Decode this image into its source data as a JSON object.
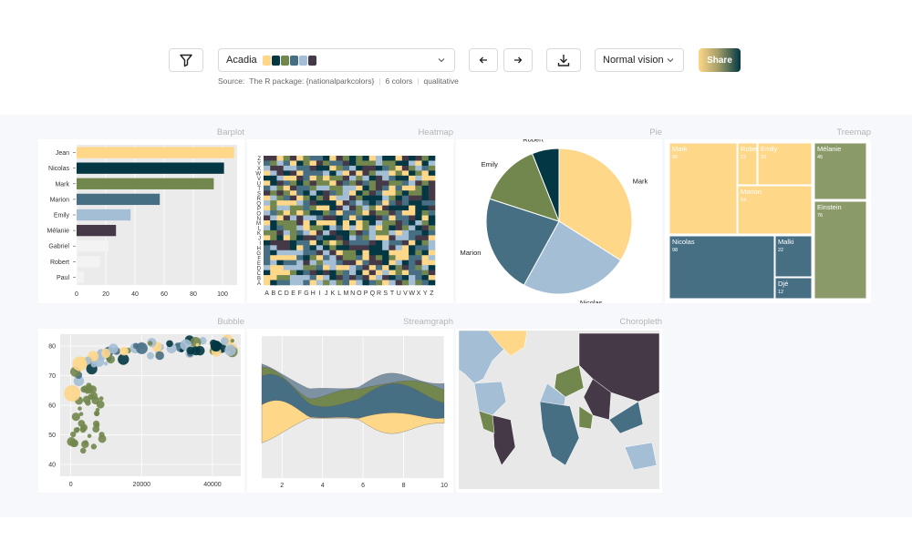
{
  "toolbar": {
    "palette_name": "Acadia",
    "palette_colors": [
      "#FED789",
      "#023743",
      "#72874E",
      "#476F84",
      "#A4BED5",
      "#453947"
    ],
    "vision_label": "Normal vision",
    "share_label": "Share",
    "source_label": "Source:",
    "source_value": "The R package: {nationalparkcolors}",
    "colors_count": "6 colors",
    "palette_type": "qualitative"
  },
  "panels": {
    "barplot": "Barplot",
    "heatmap": "Heatmap",
    "pie": "Pie",
    "treemap": "Treemap",
    "bubble": "Bubble",
    "streamgraph": "Streamgraph",
    "choropleth": "Choropleth"
  },
  "chart_data": [
    {
      "type": "bar",
      "categories": [
        "Jean",
        "Nicolas",
        "Mark",
        "Marion",
        "Emily",
        "Mélanie",
        "Gabriel",
        "Robert",
        "Paul"
      ],
      "values": [
        108,
        101,
        94,
        57,
        37,
        27,
        22,
        16,
        5
      ],
      "colors": [
        "#FED789",
        "#023743",
        "#72874E",
        "#476F84",
        "#A4BED5",
        "#453947",
        "#f3f3f3",
        "#f3f3f3",
        "#f3f3f3"
      ],
      "xticks": [
        0,
        20,
        40,
        60,
        80,
        100
      ],
      "xlim": [
        0,
        110
      ]
    },
    {
      "type": "heatmap",
      "x_labels": [
        "A",
        "B",
        "C",
        "D",
        "E",
        "F",
        "G",
        "H",
        "I",
        "J",
        "K",
        "L",
        "M",
        "N",
        "O",
        "P",
        "Q",
        "R",
        "S",
        "T",
        "U",
        "V",
        "W",
        "X",
        "Y",
        "Z"
      ],
      "y_labels": [
        "A",
        "B",
        "C",
        "D",
        "E",
        "F",
        "G",
        "H",
        "I",
        "J",
        "K",
        "L",
        "M",
        "N",
        "O",
        "P",
        "Q",
        "R",
        "S",
        "T",
        "U",
        "V",
        "W",
        "X",
        "Y",
        "Z"
      ]
    },
    {
      "type": "pie",
      "labels": [
        "Mark",
        "Nicolas",
        "Marion",
        "Emily",
        "Robert"
      ],
      "values": [
        34,
        24,
        22,
        14,
        6
      ],
      "colors": [
        "#FED789",
        "#A4BED5",
        "#476F84",
        "#72874E",
        "#023743"
      ]
    },
    {
      "type": "treemap",
      "items": [
        {
          "name": "Mark",
          "value": 90,
          "color": "#FED789"
        },
        {
          "name": "Robert",
          "value": 12,
          "color": "#FED789"
        },
        {
          "name": "Emily",
          "value": 33,
          "color": "#FED789"
        },
        {
          "name": "Marion",
          "value": 54,
          "color": "#FED789"
        },
        {
          "name": "Nicolas",
          "value": 98,
          "color": "#476F84"
        },
        {
          "name": "Malki",
          "value": 22,
          "color": "#476F84"
        },
        {
          "name": "Djé",
          "value": 12,
          "color": "#476F84"
        },
        {
          "name": "Mélanie",
          "value": 45,
          "color": "#8a9b69"
        },
        {
          "name": "Einstein",
          "value": 76,
          "color": "#8a9b69"
        }
      ],
      "display_names": [
        "Mark",
        "Robe",
        "Emily",
        "Marion",
        "Nicolas",
        "Malki",
        "Djé",
        "Mélanie",
        "Einstein"
      ]
    },
    {
      "type": "scatter",
      "xticks": [
        0,
        20000,
        40000
      ],
      "yticks": [
        40,
        50,
        60,
        70,
        80
      ],
      "xlim": [
        -3000,
        48000
      ],
      "ylim": [
        36,
        84
      ]
    },
    {
      "type": "area",
      "xticks": [
        2,
        4,
        6,
        8,
        10
      ],
      "xlim": [
        1,
        10
      ]
    },
    {
      "type": "map"
    }
  ]
}
